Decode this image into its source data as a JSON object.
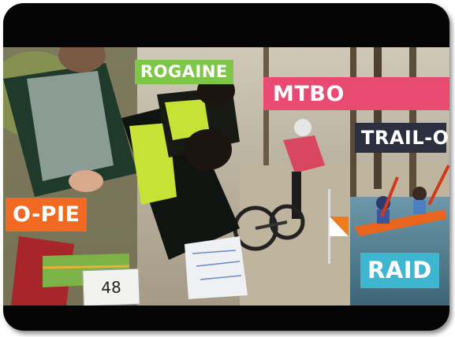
{
  "labels": {
    "rogaine": "ROGAINE",
    "mtbo": "MTBO",
    "traillo": "TRAIL-O",
    "opie": "O-PIE",
    "raid": "RAID"
  },
  "bib_number": "48",
  "colors": {
    "frame": "#050505",
    "rogaine_bg": "#7ec648",
    "mtbo_bg": "#e84a72",
    "traillo_bg": "#2b2f3f",
    "opie_bg": "#f26a22",
    "raid_bg": "#3fb6d0"
  }
}
